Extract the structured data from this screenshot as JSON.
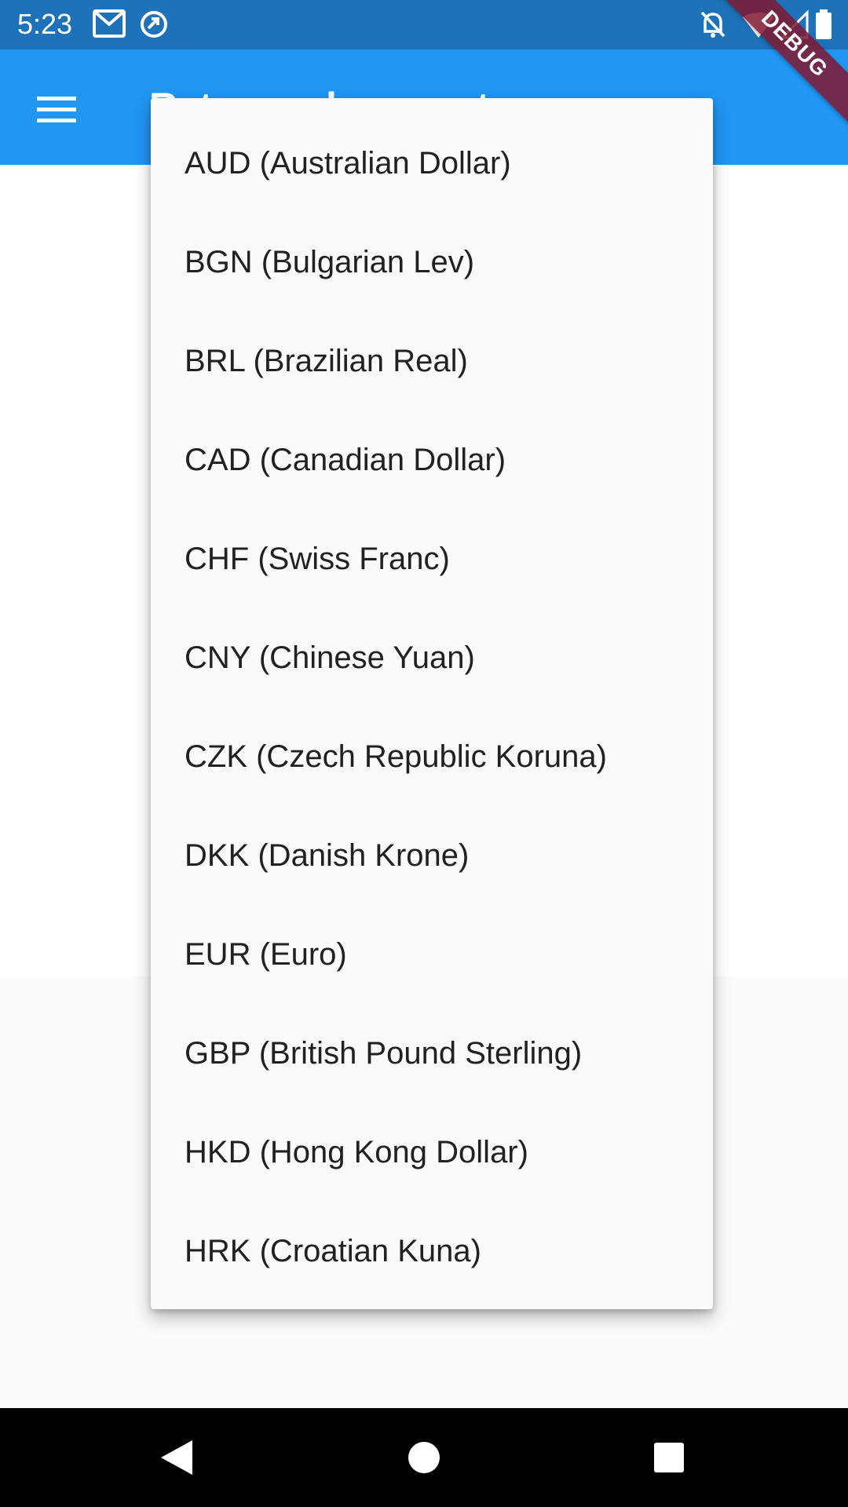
{
  "status_bar": {
    "time": "5:23",
    "icons_left": [
      "gmail-icon",
      "sync-icon"
    ],
    "icons_right": [
      "notifications-off-icon",
      "wifi-icon",
      "cellular-signal-icon",
      "battery-icon"
    ]
  },
  "app_bar": {
    "title": "Rates and converter",
    "menu_icon": "menu-icon",
    "background": "#2196f3"
  },
  "debug_banner": {
    "label": "DEBUG"
  },
  "dropdown": {
    "items": [
      {
        "label": "AUD (Australian Dollar)"
      },
      {
        "label": "BGN (Bulgarian Lev)"
      },
      {
        "label": "BRL (Brazilian Real)"
      },
      {
        "label": "CAD (Canadian Dollar)"
      },
      {
        "label": "CHF (Swiss Franc)"
      },
      {
        "label": "CNY (Chinese Yuan)"
      },
      {
        "label": "CZK (Czech Republic Koruna)"
      },
      {
        "label": "DKK (Danish Krone)"
      },
      {
        "label": "EUR (Euro)"
      },
      {
        "label": "GBP (British Pound Sterling)"
      },
      {
        "label": "HKD (Hong Kong Dollar)"
      },
      {
        "label": "HRK (Croatian Kuna)"
      }
    ]
  },
  "nav_bar": {
    "buttons": [
      "back-icon",
      "home-icon",
      "recents-icon"
    ]
  },
  "colors": {
    "status_bar": "#1e72ba",
    "app_bar": "#2196f3",
    "menu_background": "#fafafa",
    "text": "#212121"
  }
}
